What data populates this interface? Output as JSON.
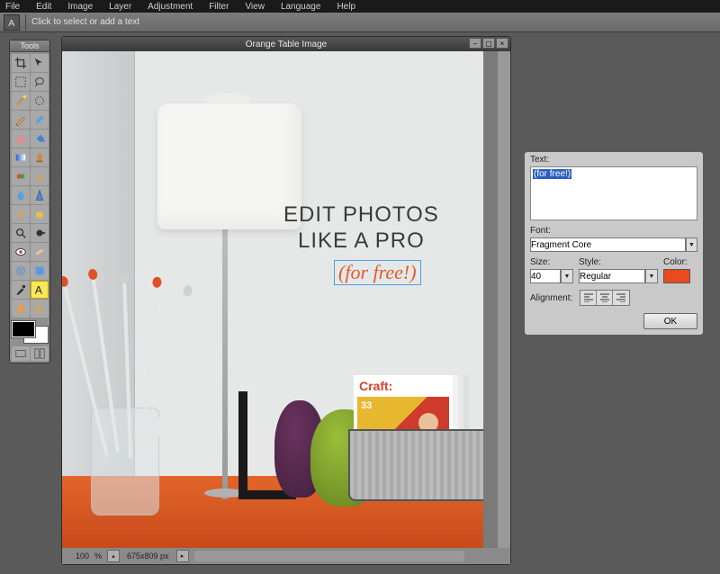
{
  "menubar": [
    "File",
    "Edit",
    "Image",
    "Layer",
    "Adjustment",
    "Filter",
    "View",
    "Language",
    "Help"
  ],
  "options_bar": {
    "prompt": "Click to select or add a text"
  },
  "tools_panel": {
    "title": "Tools"
  },
  "document": {
    "title": "Orange Table Image",
    "zoom": "100",
    "zoom_unit": "%",
    "dimensions": "675x809 px",
    "overlay_line1": "EDIT PHOTOS",
    "overlay_line2": "LIKE A PRO",
    "overlay_sub": "(for free!)",
    "magazine_title": "Craft:",
    "magazine_number": "33"
  },
  "text_panel": {
    "text_label": "Text:",
    "text_value": "(for free!)",
    "font_label": "Font:",
    "font_value": "Fragment Core",
    "size_label": "Size:",
    "size_value": "40",
    "style_label": "Style:",
    "style_value": "Regular",
    "color_label": "Color:",
    "color_value": "#ea4a1d",
    "align_label": "Alignment:",
    "ok_label": "OK"
  }
}
